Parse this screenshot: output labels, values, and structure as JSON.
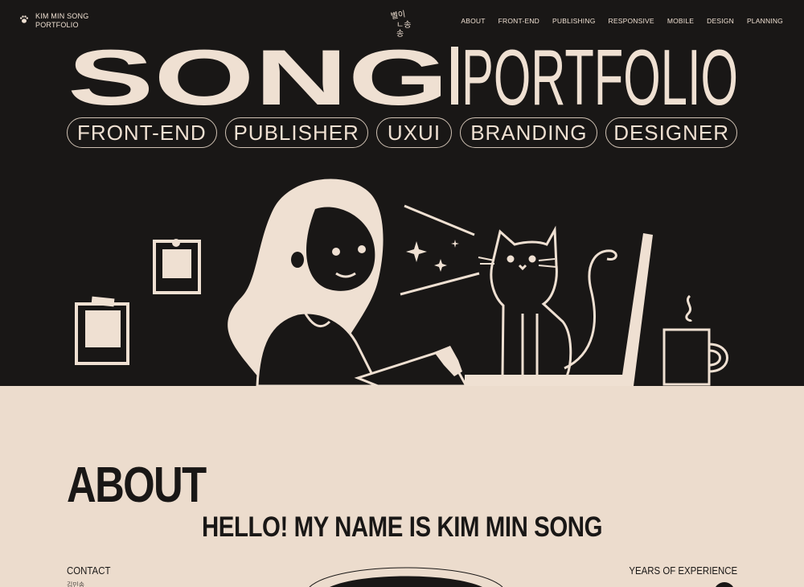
{
  "header": {
    "brand_line1": "KIM MIN SONG",
    "brand_line2": "PORTFOLIO",
    "logo_line1": "별이",
    "logo_line2": "ㄴ송송",
    "nav": [
      "ABOUT",
      "FRONT-END",
      "PUBLISHING",
      "RESPONSIVE",
      "MOBILE",
      "DESIGN",
      "PLANNING"
    ]
  },
  "hero": {
    "title_left": "SONG",
    "title_right": "PORTFOLIO",
    "pills": [
      "FRONT-END",
      "PUBLISHER",
      "UXUI",
      "BRANDING",
      "DESIGNER"
    ]
  },
  "about": {
    "title": "ABOUT",
    "hello": "HELLO! MY NAME IS KIM MIN SONG",
    "contact_label": "CONTACT",
    "contact_name": "김민송",
    "years_label": "YEARS OF EXPERIENCE"
  },
  "colors": {
    "dark": "#191716",
    "cream": "#efe0d2",
    "about_bg": "#ecdccd"
  },
  "icons": [
    "paw-icon",
    "star-sparkle-icon"
  ]
}
